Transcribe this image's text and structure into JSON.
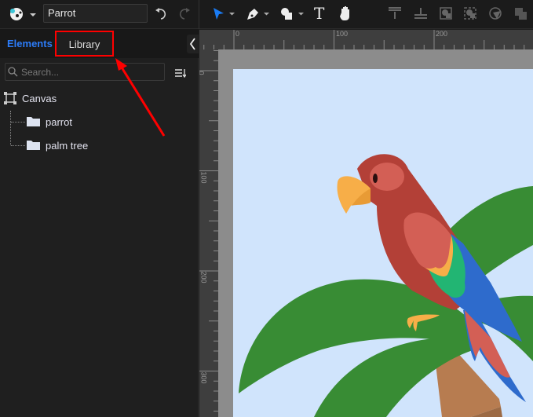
{
  "toolbar": {
    "document_name": "Parrot",
    "tools": [
      "logo-menu",
      "undo",
      "redo",
      "select-tool",
      "pen-tool",
      "shape-tool",
      "text-tool",
      "hand-tool",
      "align-top",
      "align-middle",
      "mask",
      "group",
      "clip",
      "combine"
    ],
    "accent": "#1a7cf5"
  },
  "panel": {
    "tabs": [
      {
        "label": "Elements",
        "active": true
      },
      {
        "label": "Library",
        "active": false,
        "highlighted": true
      }
    ],
    "search_placeholder": "Search...",
    "tree": {
      "root": "Canvas",
      "children": [
        {
          "label": "parrot",
          "icon": "folder"
        },
        {
          "label": "palm tree",
          "icon": "folder"
        }
      ]
    }
  },
  "ruler": {
    "horizontal": [
      "0",
      "100",
      "200"
    ],
    "vertical": [
      "0",
      "100",
      "200",
      "300"
    ]
  },
  "annotation": {
    "highlight_color": "#ff0000",
    "target": "Library"
  },
  "colors": {
    "page_bg": "#d0e4fc",
    "leaf": "#388c34",
    "trunk": "#b77c50",
    "parrot_red": "#b34037",
    "wing": "#d35f55",
    "beak": "#f7ae48",
    "green_feather": "#22b573",
    "blue_feather": "#2e6bcc"
  }
}
